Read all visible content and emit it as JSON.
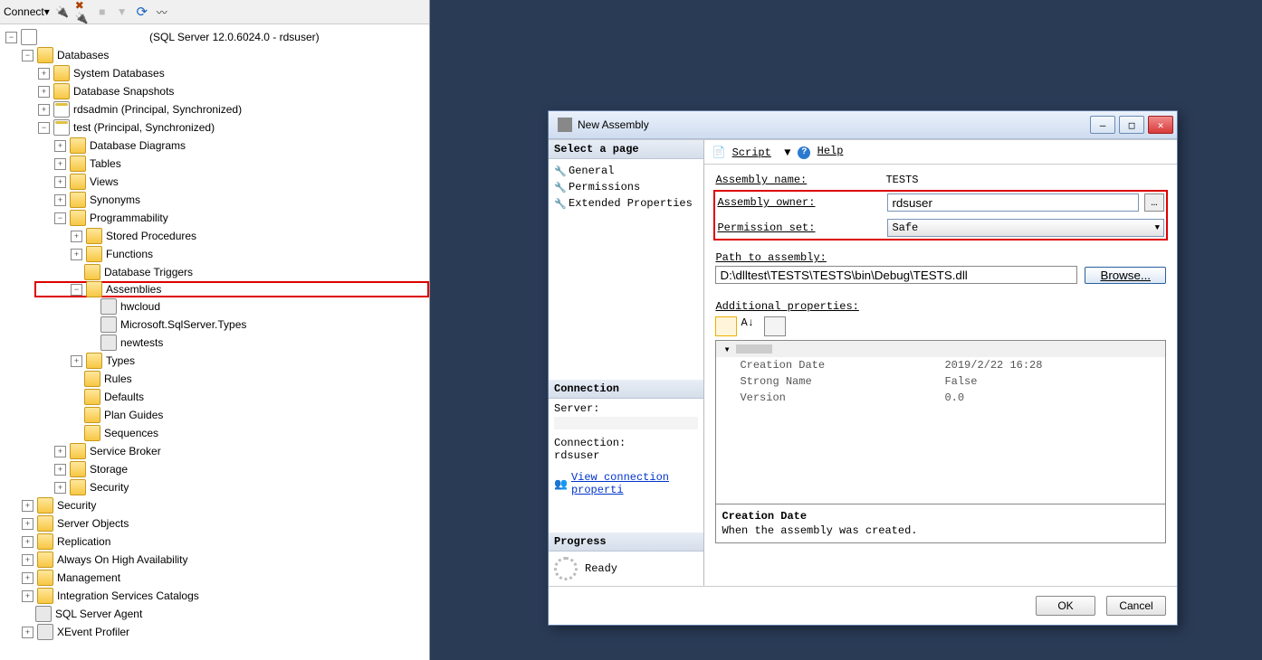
{
  "toolbar": {
    "connect_label": "Connect",
    "arrow": "▾"
  },
  "server_line": "(SQL Server 12.0.6024.0 - rdsuser)",
  "tree": {
    "databases": "Databases",
    "system_databases": "System Databases",
    "db_snapshots": "Database Snapshots",
    "rdsadmin": "rdsadmin (Principal, Synchronized)",
    "test": "test (Principal, Synchronized)",
    "db_diagrams": "Database Diagrams",
    "tables": "Tables",
    "views": "Views",
    "synonyms": "Synonyms",
    "programmability": "Programmability",
    "stored_procs": "Stored Procedures",
    "functions": "Functions",
    "db_triggers": "Database Triggers",
    "assemblies": "Assemblies",
    "asm_hwcloud": "hwcloud",
    "asm_mssst": "Microsoft.SqlServer.Types",
    "asm_newtests": "newtests",
    "types": "Types",
    "rules": "Rules",
    "defaults": "Defaults",
    "plan_guides": "Plan Guides",
    "sequences": "Sequences",
    "service_broker": "Service Broker",
    "storage": "Storage",
    "security_db": "Security",
    "security": "Security",
    "server_objects": "Server Objects",
    "replication": "Replication",
    "always_on": "Always On High Availability",
    "management": "Management",
    "isc": "Integration Services Catalogs",
    "sql_agent": "SQL Server Agent",
    "xevent": "XEvent Profiler"
  },
  "dialog": {
    "title": "New Assembly",
    "select_page": "Select a page",
    "pages": {
      "general": "General",
      "permissions": "Permissions",
      "extended": "Extended Properties"
    },
    "connection_hdr": "Connection",
    "server_label": "Server:",
    "connection_label": "Connection:",
    "connection_value": "rdsuser",
    "view_conn_link": "View connection properti",
    "progress_hdr": "Progress",
    "progress_status": "Ready",
    "script_label": "Script",
    "script_arrow": "▼",
    "help_label": "Help",
    "form": {
      "assembly_name_label": "Assembly name:",
      "assembly_name_value": "TESTS",
      "assembly_owner_label": "Assembly owner:",
      "assembly_owner_value": "rdsuser",
      "owner_btn": "…",
      "permission_set_label": "Permission set:",
      "permission_set_value": "Safe",
      "path_label": "Path to assembly:",
      "path_value": "D:\\dlltest\\TESTS\\TESTS\\bin\\Debug\\TESTS.dll",
      "browse": "Browse...",
      "addl_props": "Additional properties:"
    },
    "props": {
      "creation_date_label": "Creation Date",
      "creation_date_value": "2019/2/22 16:28",
      "strong_name_label": "Strong Name",
      "strong_name_value": "False",
      "version_label": "Version",
      "version_value": "0.0"
    },
    "desc": {
      "title": "Creation Date",
      "text": "When the assembly was created."
    },
    "buttons": {
      "ok": "OK",
      "cancel": "Cancel"
    }
  }
}
